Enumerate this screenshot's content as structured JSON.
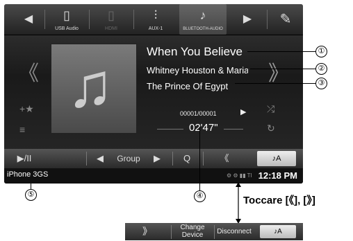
{
  "source_bar": {
    "left_arrow": "◀",
    "sources": [
      {
        "label": "USB Audio",
        "icon": "usb-icon"
      },
      {
        "label": "HDMI",
        "icon": "hdmi-icon"
      },
      {
        "label": "AUX-1",
        "icon": "aux-icon",
        "badge": "1"
      },
      {
        "label": "BLUETOOTH-AUDIO",
        "icon": "bluetooth-audio-icon"
      }
    ],
    "right_arrow": "▶",
    "setup_icon": "setup-icon"
  },
  "track": {
    "title": "When You Believe",
    "artist": "Whitney Houston & Maria",
    "album": "The Prince Of Egypt",
    "counter": "00001/00001",
    "time": "02'47\""
  },
  "controls": {
    "play_pause": "▶/II",
    "group_left": "◀",
    "group_label": "Group",
    "group_right": "▶",
    "search": "Q",
    "more": "《"
  },
  "status": {
    "device": "iPhone 3GS",
    "clock": "12:18 PM"
  },
  "callouts": [
    "①",
    "②",
    "③",
    "④",
    "⑤"
  ],
  "instruction": "Toccare [《], [》]",
  "alt_bar": {
    "back": "》",
    "change_device_1": "Change",
    "change_device_2": "Device",
    "disconnect": "Disconnect"
  }
}
